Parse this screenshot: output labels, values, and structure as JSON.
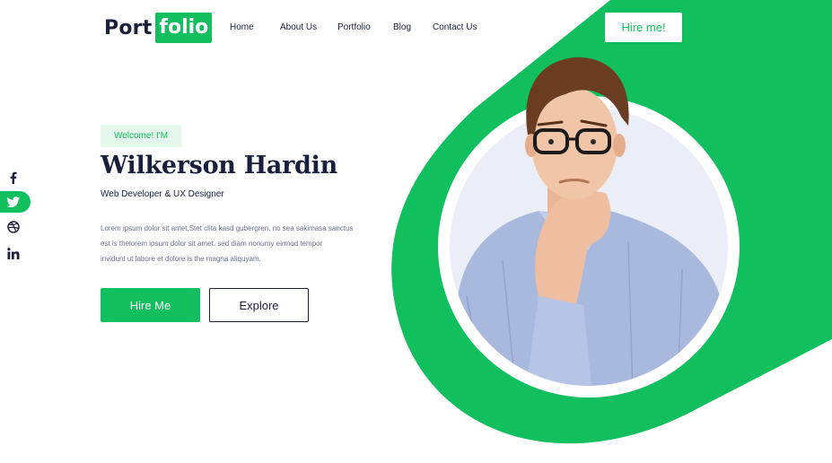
{
  "logo": {
    "part1": "Port",
    "part2": "folio"
  },
  "nav": [
    {
      "label": "Home"
    },
    {
      "label": "About Us"
    },
    {
      "label": "Portfolio"
    },
    {
      "label": "Blog"
    },
    {
      "label": "Contact Us"
    }
  ],
  "header": {
    "hire_label": "Hire me!"
  },
  "social": [
    {
      "icon": "facebook-icon"
    },
    {
      "icon": "twitter-icon",
      "active": true
    },
    {
      "icon": "dribbble-icon"
    },
    {
      "icon": "linkedin-icon"
    }
  ],
  "hero": {
    "welcome": "Welcome! I'M",
    "name": "Wilkerson Hardin",
    "role": "Web Developer & UX Designer",
    "description_lines": [
      "Lorem ipsum dolor sit amet,Stet clita kasd gubergren, no sea sakimasa sanctus",
      "est is thelorem ipsum dolor sit amet. sed diam nonumy eirmod tempor",
      "invidunt ut labore et dolore is the magna aliquyam."
    ],
    "hire_button": "Hire Me",
    "explore_button": "Explore"
  },
  "colors": {
    "accent": "#12bf5e",
    "dark": "#1a1f3c",
    "welcome_bg": "#e3f7ec"
  }
}
